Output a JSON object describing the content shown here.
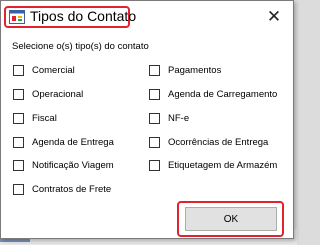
{
  "window": {
    "title": "Tipos do Contato",
    "close_glyph": "✕"
  },
  "subtitle": "Selecione o(s) tipo(s) do contato",
  "left_column": [
    {
      "label": "Comercial",
      "checked": false
    },
    {
      "label": "Operacional",
      "checked": false
    },
    {
      "label": "Fiscal",
      "checked": false
    },
    {
      "label": "Agenda de Entrega",
      "checked": false
    },
    {
      "label": "Notificação Viagem",
      "checked": false
    },
    {
      "label": "Contratos de Frete",
      "checked": false
    }
  ],
  "right_column": [
    {
      "label": "Pagamentos",
      "checked": false
    },
    {
      "label": "Agenda de Carregamento",
      "checked": false
    },
    {
      "label": "NF-e",
      "checked": false
    },
    {
      "label": "Ocorrências de Entrega",
      "checked": false
    },
    {
      "label": "Etiquetagem de Armazém",
      "checked": false
    }
  ],
  "ok_button": {
    "label": "OK"
  },
  "colors": {
    "highlight": "#e0232f",
    "button_bg": "#e1e1e1"
  },
  "icons": {
    "app": "app-window-icon",
    "close": "close-icon"
  }
}
